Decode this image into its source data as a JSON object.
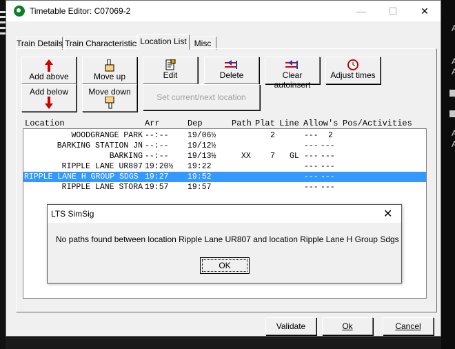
{
  "window": {
    "title": "Timetable Editor: C07069-2",
    "minimize": "—",
    "maximize": "☐",
    "close": "✕"
  },
  "tabs": [
    {
      "label": "Train Details"
    },
    {
      "label": "Train Characteristics"
    },
    {
      "label": "Location List"
    },
    {
      "label": "Misc"
    }
  ],
  "toolbar": {
    "add_above": "Add above",
    "add_below": "Add below",
    "move_up": "Move up",
    "move_down": "Move down",
    "edit": "Edit",
    "delete": "Delete",
    "clear_autoinsert": "Clear autoinsert",
    "adjust_times": "Adjust times",
    "set_current_next": "Set current/next location"
  },
  "list": {
    "headers": {
      "location": "Location",
      "arr": "Arr",
      "dep": "Dep",
      "path": "Path",
      "plat": "Plat",
      "line": "Line",
      "allows": "Allow's",
      "pos": "Pos/Activities"
    },
    "rows": [
      {
        "location": "WOODGRANGE PARK",
        "arr": "--:--",
        "dep": "19/06½",
        "path": "",
        "plat": "2",
        "line": "",
        "allows": "---",
        "pos": "2"
      },
      {
        "location": "BARKING STATION JN",
        "arr": "--:--",
        "dep": "19/12½",
        "path": "",
        "plat": "",
        "line": "",
        "allows": "---",
        "pos": "---"
      },
      {
        "location": "BARKING",
        "arr": "--:--",
        "dep": "19/13½",
        "path": "XX",
        "plat": "7",
        "line": "GL",
        "allows": "---",
        "pos": "---"
      },
      {
        "location": "RIPPLE LANE UR807",
        "arr": "19:20½",
        "dep": "19:22",
        "path": "",
        "plat": "",
        "line": "",
        "allows": "---",
        "pos": "---"
      },
      {
        "location": "RIPPLE LANE H GROUP SDGS",
        "arr": "19:27",
        "dep": "19:52",
        "path": "",
        "plat": "",
        "line": "",
        "allows": "---",
        "pos": "---"
      },
      {
        "location": "RIPPLE LANE STORA",
        "arr": "19:57",
        "dep": "19:57",
        "path": "",
        "plat": "",
        "line": "",
        "allows": "---",
        "pos": "---"
      }
    ]
  },
  "dialog": {
    "title": "LTS SimSig",
    "close": "✕",
    "message": "No paths found between location Ripple Lane UR807 and location Ripple Lane H Group Sdgs",
    "ok": "OK"
  },
  "footer": {
    "validate": "Validate",
    "ok": "Ok",
    "cancel": "Cancel"
  },
  "background": {
    "glyph_1": "A",
    "glyph_2": "A",
    "glyph_3": "A",
    "glyph_4": "A",
    "glyph_5": "A"
  },
  "colors": {
    "selection": "#3399ff",
    "window_bg": "#f0f0f0",
    "red_arrow": "#d00000",
    "app_icon": "#0b7f2a"
  }
}
